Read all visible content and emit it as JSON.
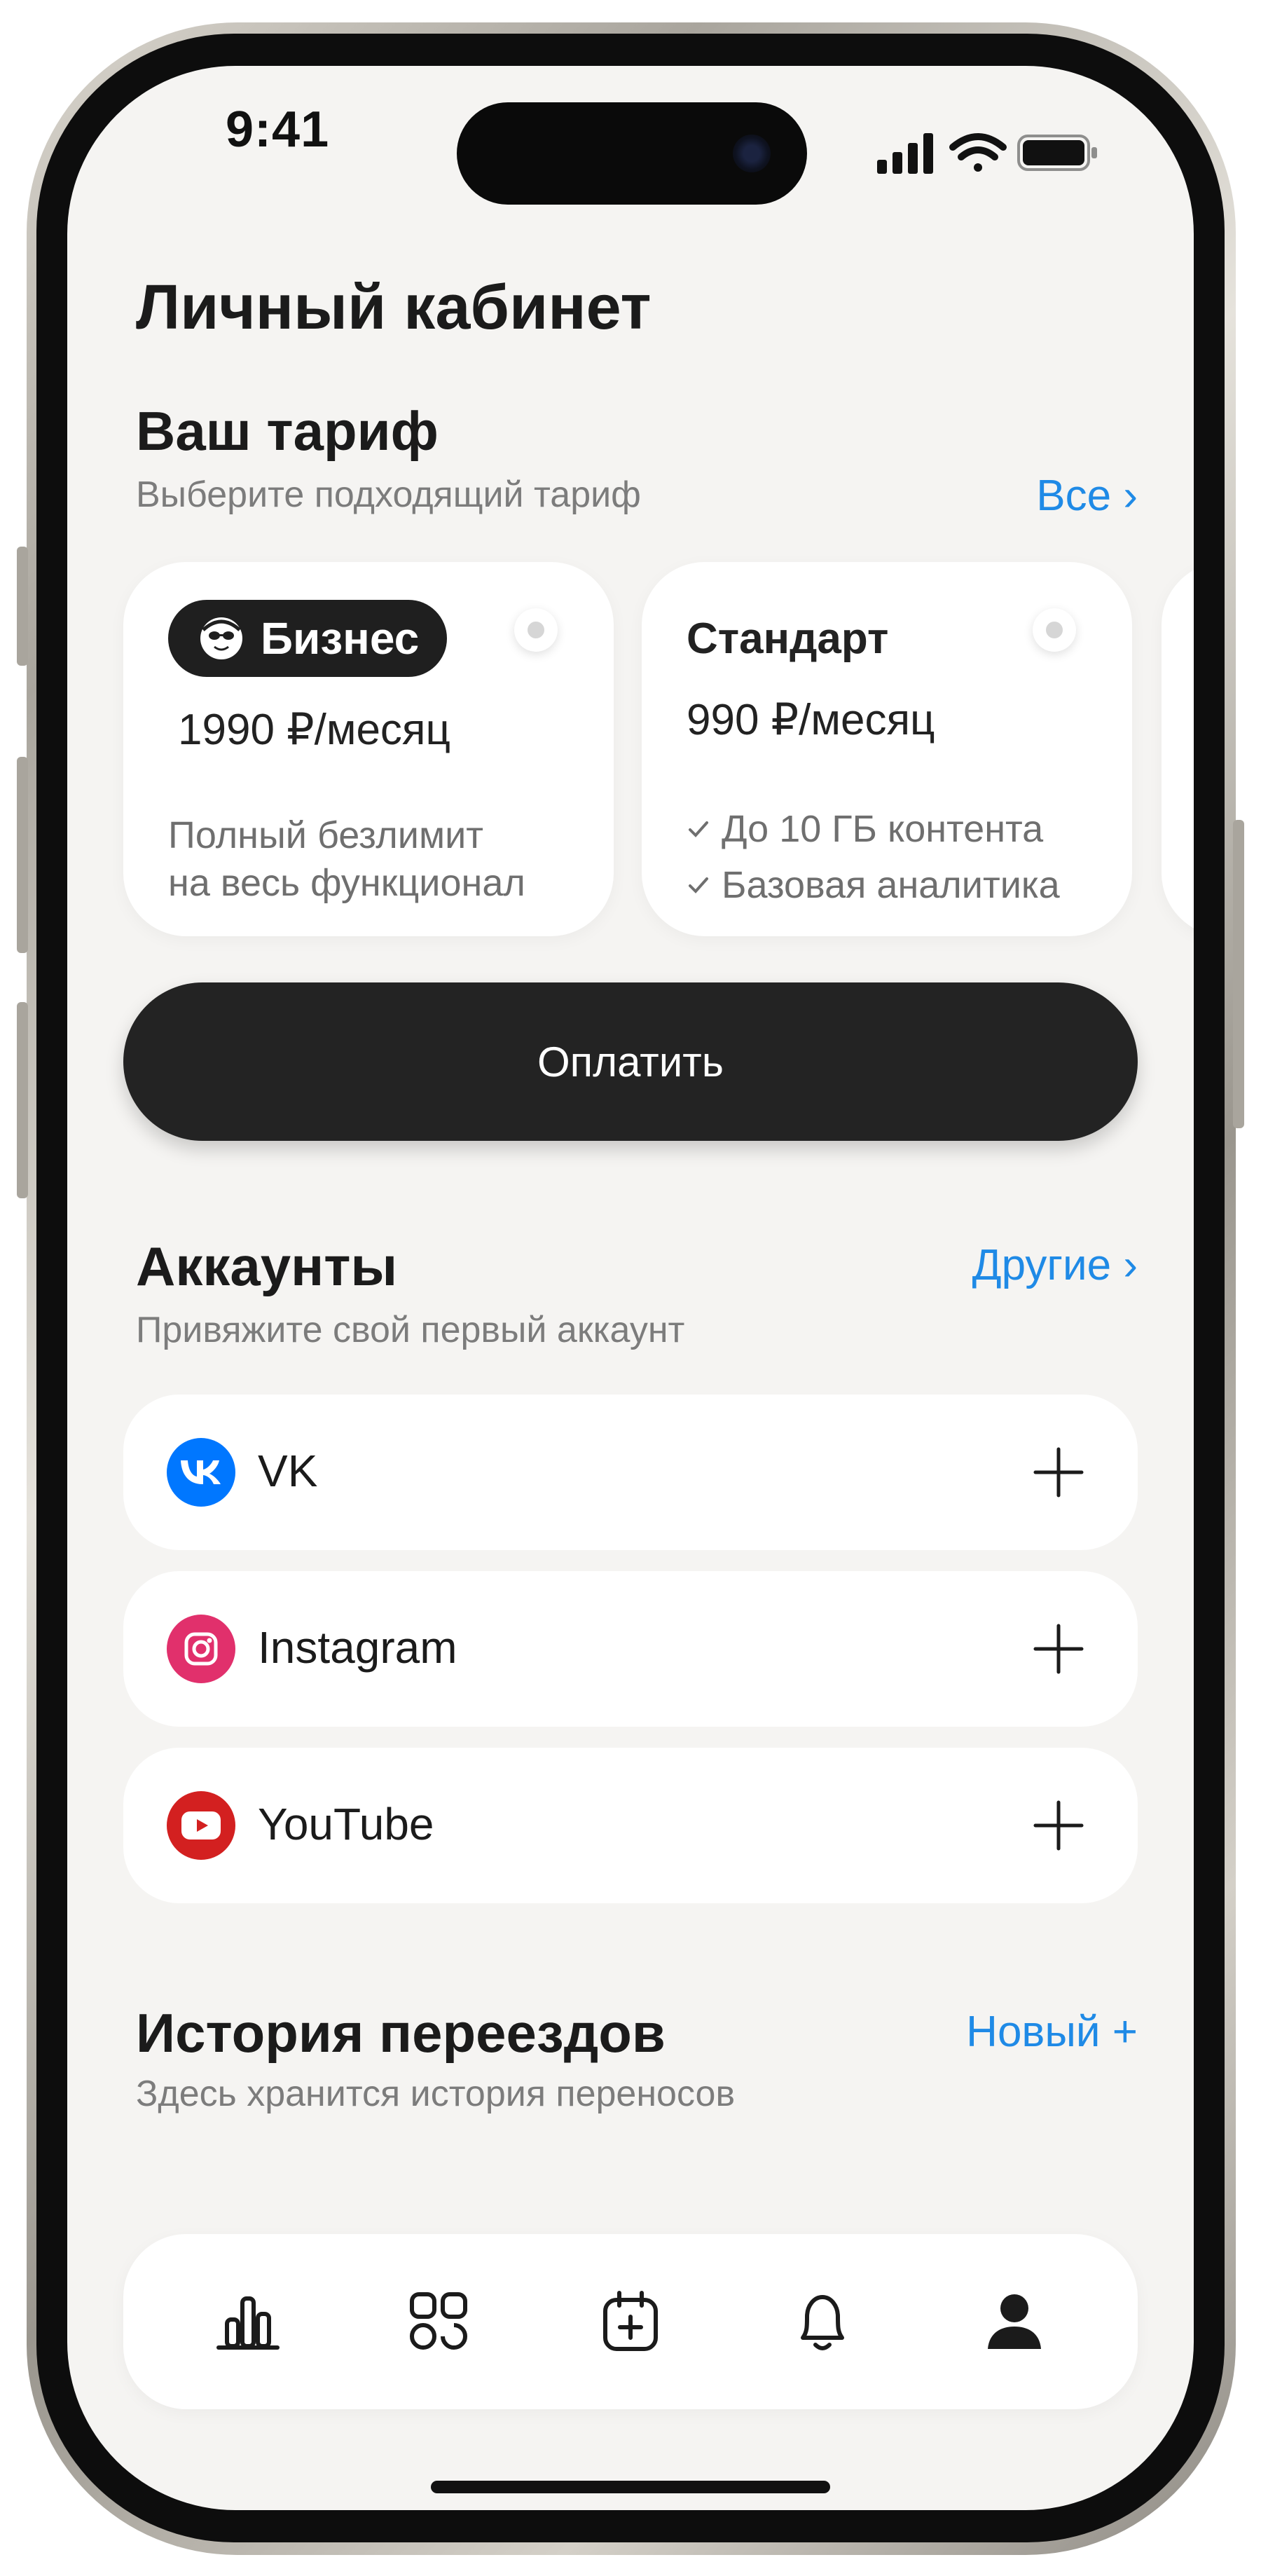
{
  "status_bar": {
    "time": "9:41"
  },
  "header": {
    "title": "Личный кабинет"
  },
  "tariff": {
    "title": "Ваш тариф",
    "subtitle": "Выберите подходящий тариф",
    "all_link": "Все ›",
    "cards": [
      {
        "name": "Бизнес",
        "price": "1990 ₽/месяц",
        "desc_line1": "Полный безлимит",
        "desc_line2": "на весь функционал"
      },
      {
        "name": "Стандарт",
        "price": "990 ₽/месяц",
        "features": [
          "До 10 ГБ контента",
          "Базовая аналитика"
        ]
      }
    ],
    "pay_button": "Оплатить"
  },
  "accounts": {
    "title": "Аккаунты",
    "other_link": "Другие ›",
    "subtitle": "Привяжите свой первый аккаунт",
    "items": [
      {
        "name": "VK",
        "icon": "vk-icon",
        "color": "#0077ff"
      },
      {
        "name": "Instagram",
        "icon": "instagram-icon",
        "color": "#e1306c"
      },
      {
        "name": "YouTube",
        "icon": "youtube-icon",
        "color": "#d32020"
      }
    ]
  },
  "history": {
    "title": "История переездов",
    "new_link": "Новый +",
    "subtitle": "Здесь хранится история переносов"
  },
  "tabbar": {
    "items": [
      {
        "icon": "analytics-icon"
      },
      {
        "icon": "apps-icon"
      },
      {
        "icon": "calendar-add-icon"
      },
      {
        "icon": "bell-icon"
      },
      {
        "icon": "profile-icon",
        "active": true
      }
    ]
  },
  "colors": {
    "accent": "#1f8ae6",
    "dark": "#232323",
    "background": "#f5f4f2"
  }
}
